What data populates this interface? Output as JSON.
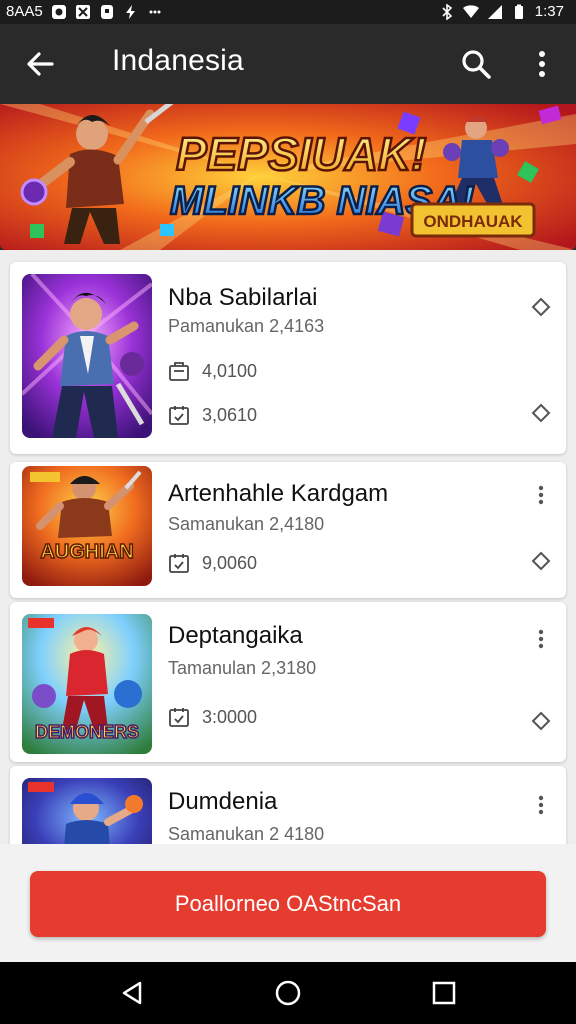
{
  "status_bar": {
    "left_text": "8AA5",
    "time": "1:37",
    "left_icons": [
      "record-icon",
      "gallery-icon",
      "notification-icon",
      "flash-icon",
      "dots-icon"
    ],
    "right_icons": [
      "bluetooth-icon",
      "wifi-icon",
      "signal-icon",
      "battery-icon"
    ]
  },
  "app_bar": {
    "title": "Indanesia",
    "icons": [
      "back-arrow-icon",
      "search-icon",
      "more-vert-icon"
    ]
  },
  "banner": {
    "headline_1": "PEPSIUAK!",
    "headline_2": "MLINKB NIASA!",
    "badge": "ONDHAUAK"
  },
  "cards": [
    {
      "name": "Nba Sabilarlai",
      "subtitle": "Pamanukan 2,4163",
      "stats": [
        {
          "icon": "box-icon",
          "value": "4,0100"
        },
        {
          "icon": "calendar-check-icon",
          "value": "3,0610"
        }
      ],
      "top_icon": "diamond-icon",
      "bottom_icon": "diamond-icon",
      "thumb_caption": ""
    },
    {
      "name": "Artenhahle Kardgam",
      "subtitle": "Samanukan 2,4180",
      "stats": [
        {
          "icon": "calendar-check-icon",
          "value": "9,0060"
        }
      ],
      "top_icon": "more-vert-icon",
      "bottom_icon": "diamond-icon",
      "thumb_caption": "AUGHIAN"
    },
    {
      "name": "Deptangaika",
      "subtitle": "Tamanulan 2,3180",
      "stats": [
        {
          "icon": "calendar-check-icon",
          "value": "3:0000"
        }
      ],
      "top_icon": "more-vert-icon",
      "bottom_icon": "diamond-icon",
      "thumb_caption": "DEMONERS"
    },
    {
      "name": "Dumdenia",
      "subtitle": "Samanukan 2 4180",
      "stats": [],
      "top_icon": "more-vert-icon",
      "bottom_icon": "",
      "thumb_caption": ""
    }
  ],
  "cta": {
    "label": "Poallorneo OAStncSan",
    "color": "#e53c2f"
  },
  "nav_bar": {
    "buttons": [
      "back-triangle-icon",
      "home-circle-icon",
      "recents-square-icon"
    ]
  }
}
